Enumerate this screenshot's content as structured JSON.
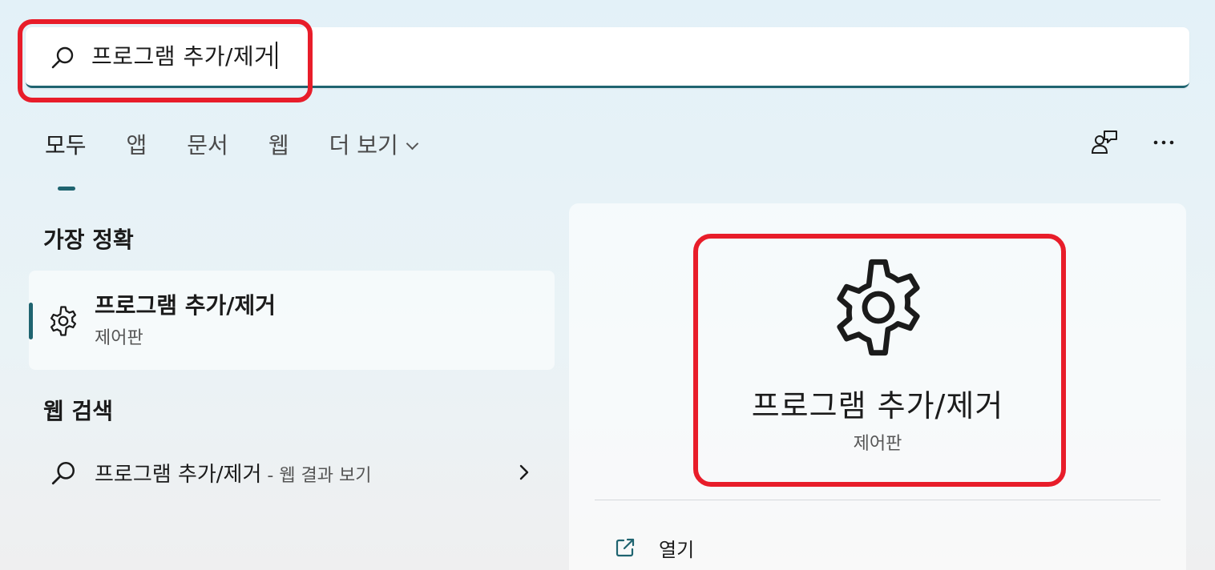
{
  "search": {
    "query": "프로그램 추가/제거"
  },
  "tabs": [
    {
      "label": "모두",
      "active": true
    },
    {
      "label": "앱"
    },
    {
      "label": "문서"
    },
    {
      "label": "웹"
    },
    {
      "label": "더 보기"
    }
  ],
  "toolbar": {
    "icons": [
      "feedback-icon",
      "more-options-icon"
    ]
  },
  "best_match": {
    "section_title": "가장 정확",
    "title": "프로그램 추가/제거",
    "subtitle": "제어판",
    "icon": "gear-icon"
  },
  "web_search": {
    "section_title": "웹 검색",
    "query": "프로그램 추가/제거",
    "suffix": " - 웹 결과 보기"
  },
  "detail": {
    "title": "프로그램 추가/제거",
    "subtitle": "제어판",
    "icon": "gear-icon",
    "actions": [
      {
        "label": "열기",
        "icon": "open-external-icon"
      }
    ]
  },
  "colors": {
    "accent": "#1f6470",
    "highlight": "#e81d2a"
  }
}
